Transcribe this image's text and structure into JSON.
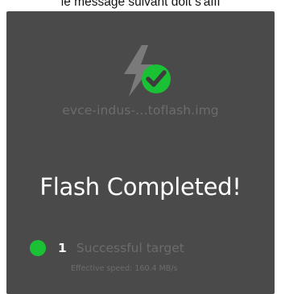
{
  "caption": "le message suivant doit s'affi",
  "dialog": {
    "filename": "evce-indus-…toflash.img",
    "headline": "Flash Completed!",
    "result": {
      "count": "1",
      "label": "Successful target",
      "status_color": "#1ac135"
    },
    "speed": "Effective speed: 160.4 MB/s"
  },
  "icons": {
    "flash": "lightning-bolt-icon",
    "success": "checkmark-circle-icon"
  },
  "colors": {
    "panel_bg": "#4a4a4a",
    "success_green": "#1ac135",
    "muted_text": "#6c6c6c",
    "bolt_gray": "#7a7a7a"
  }
}
